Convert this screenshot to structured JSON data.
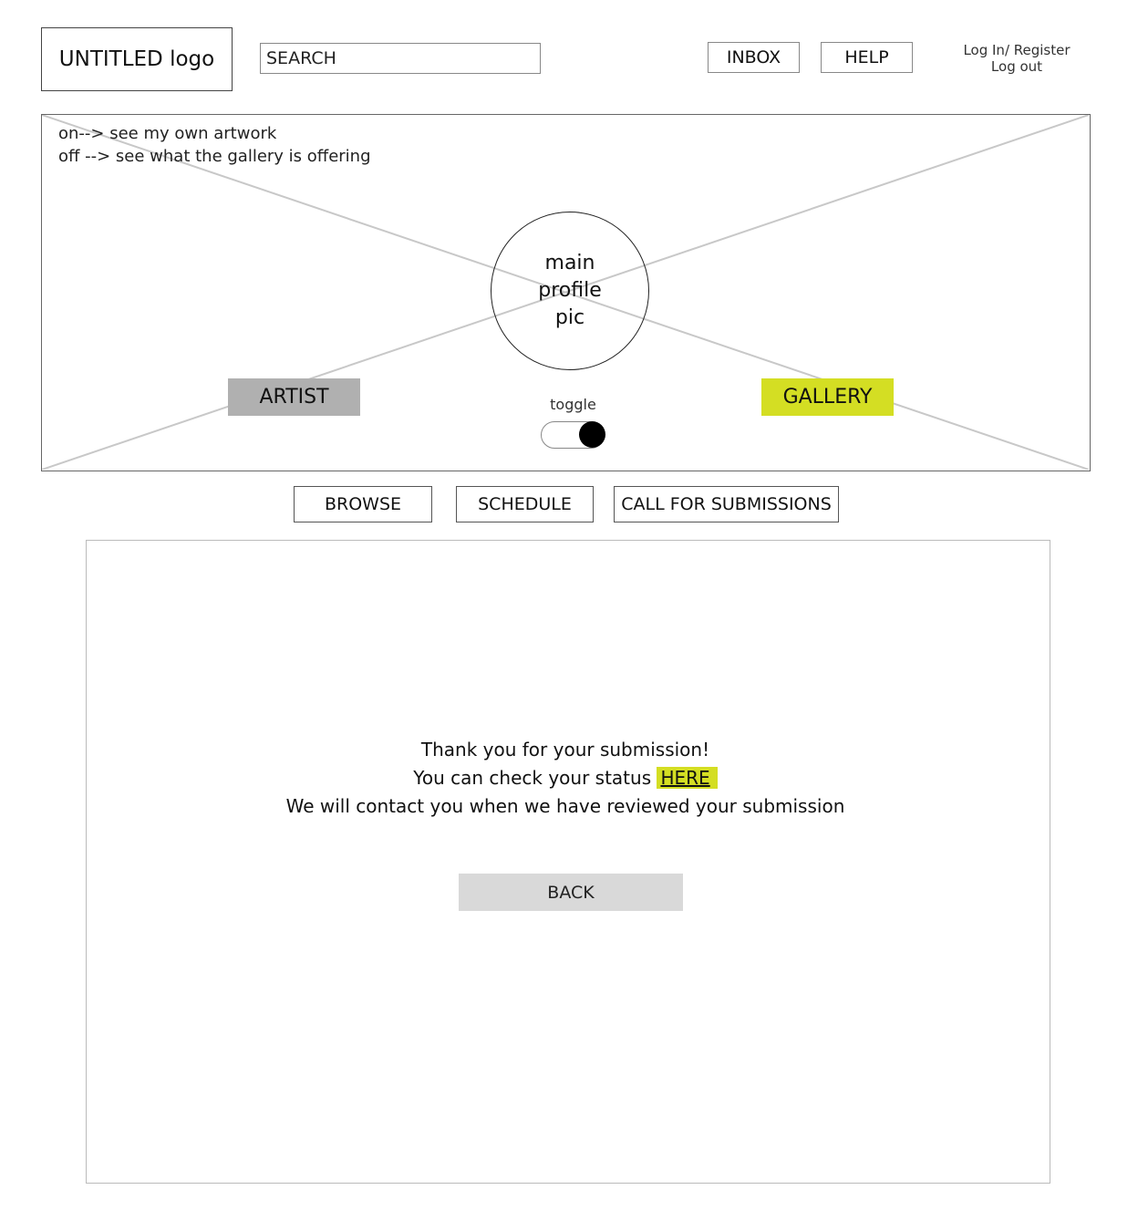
{
  "header": {
    "logo": "UNTITLED logo",
    "search": {
      "value": "",
      "placeholder": "SEARCH"
    },
    "inbox_label": "INBOX",
    "help_label": "HELP",
    "auth": {
      "login_register": "Log In/ Register",
      "logout": "Log out"
    }
  },
  "banner": {
    "note_on": "on--> see my own artwork",
    "note_off": "off --> see what the gallery is offering",
    "profile_pic": {
      "line1": "main",
      "line2": "profile",
      "line3": "pic"
    },
    "artist_label": "ARTIST",
    "gallery_label": "GALLERY",
    "toggle_label": "toggle",
    "toggle_state": "on"
  },
  "nav": {
    "browse": "BROWSE",
    "schedule": "SCHEDULE",
    "call_for_submissions": "CALL FOR SUBMISSIONS"
  },
  "confirmation": {
    "line1": "Thank you for your submission!",
    "line2_prefix": "You can check your status ",
    "link_label": "HERE",
    "line3": "We will contact you when we have reviewed your submission",
    "back_label": "BACK"
  },
  "colors": {
    "accent": "#d4de23",
    "artist_bg": "#b0b0b0",
    "back_bg": "#d9d9d9"
  }
}
